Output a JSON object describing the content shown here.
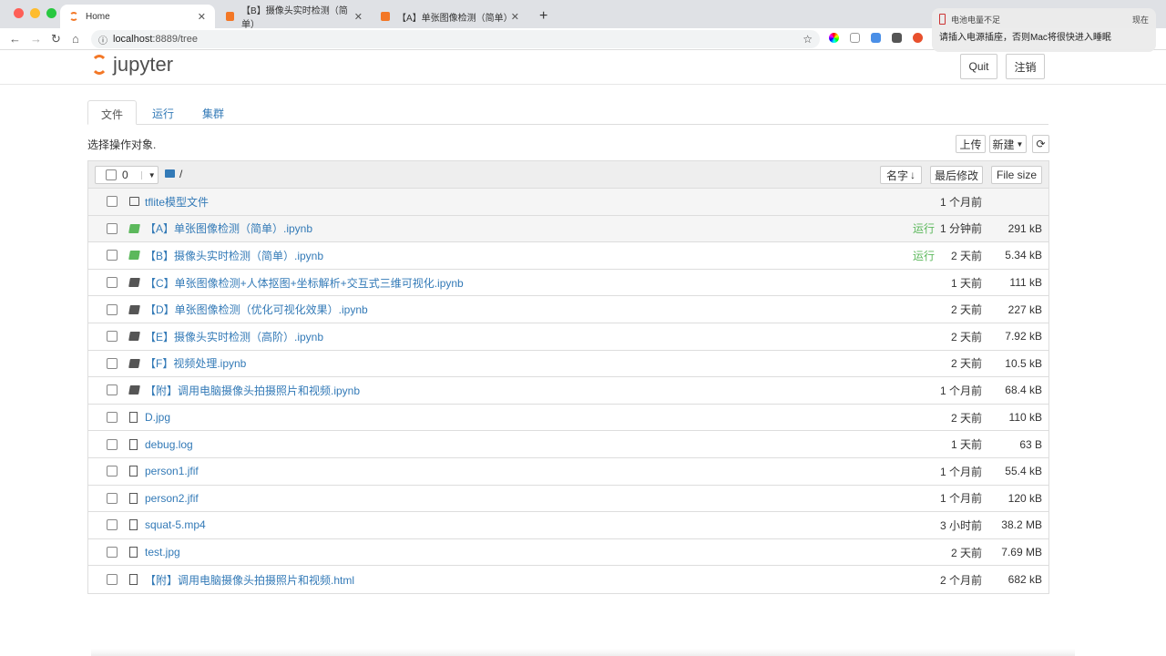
{
  "browser": {
    "tabs": [
      {
        "title": "Home",
        "active": true
      },
      {
        "title": "【B】摄像头实时检测（简单）"
      },
      {
        "title": "【A】单张图像检测（简单）- J"
      }
    ],
    "url_host": "localhost",
    "url_rest": ":8889/tree"
  },
  "notification": {
    "title": "电池电量不足",
    "time": "现在",
    "body": "请插入电源插座，否则Mac将很快进入睡眠"
  },
  "header": {
    "logo": "jupyter",
    "quit": "Quit",
    "logout": "注销"
  },
  "nav_tabs": [
    "文件",
    "运行",
    "集群"
  ],
  "toolbar": {
    "select_hint": "选择操作对象.",
    "upload": "上传",
    "new": "新建",
    "refresh_icon": "refresh-icon"
  },
  "list_header": {
    "selected_count": "0",
    "path": "/",
    "sort_name": "名字",
    "sort_modified": "最后修改",
    "sort_size": "File size"
  },
  "files": [
    {
      "name": "tflite模型文件",
      "type": "folder",
      "modified": "1 个月前",
      "size": "",
      "running": ""
    },
    {
      "name": "【A】单张图像检测（简单）.ipynb",
      "type": "notebook-running",
      "modified": "1 分钟前",
      "size": "291 kB",
      "running": "运行"
    },
    {
      "name": "【B】摄像头实时检测（简单）.ipynb",
      "type": "notebook-running",
      "modified": "2 天前",
      "size": "5.34 kB",
      "running": "运行"
    },
    {
      "name": "【C】单张图像检测+人体抠图+坐标解析+交互式三维可视化.ipynb",
      "type": "notebook",
      "modified": "1 天前",
      "size": "111 kB",
      "running": ""
    },
    {
      "name": "【D】单张图像检测（优化可视化效果）.ipynb",
      "type": "notebook",
      "modified": "2 天前",
      "size": "227 kB",
      "running": ""
    },
    {
      "name": "【E】摄像头实时检测（高阶）.ipynb",
      "type": "notebook",
      "modified": "2 天前",
      "size": "7.92 kB",
      "running": ""
    },
    {
      "name": "【F】视频处理.ipynb",
      "type": "notebook",
      "modified": "2 天前",
      "size": "10.5 kB",
      "running": ""
    },
    {
      "name": "【附】调用电脑摄像头拍摄照片和视频.ipynb",
      "type": "notebook",
      "modified": "1 个月前",
      "size": "68.4 kB",
      "running": ""
    },
    {
      "name": "D.jpg",
      "type": "file",
      "modified": "2 天前",
      "size": "110 kB",
      "running": ""
    },
    {
      "name": "debug.log",
      "type": "file",
      "modified": "1 天前",
      "size": "63 B",
      "running": ""
    },
    {
      "name": "person1.jfif",
      "type": "file",
      "modified": "1 个月前",
      "size": "55.4 kB",
      "running": ""
    },
    {
      "name": "person2.jfif",
      "type": "file",
      "modified": "1 个月前",
      "size": "120 kB",
      "running": ""
    },
    {
      "name": "squat-5.mp4",
      "type": "file",
      "modified": "3 小时前",
      "size": "38.2 MB",
      "running": ""
    },
    {
      "name": "test.jpg",
      "type": "file",
      "modified": "2 天前",
      "size": "7.69 MB",
      "running": ""
    },
    {
      "name": "【附】调用电脑摄像头拍摄照片和视频.html",
      "type": "file",
      "modified": "2 个月前",
      "size": "682 kB",
      "running": ""
    }
  ]
}
